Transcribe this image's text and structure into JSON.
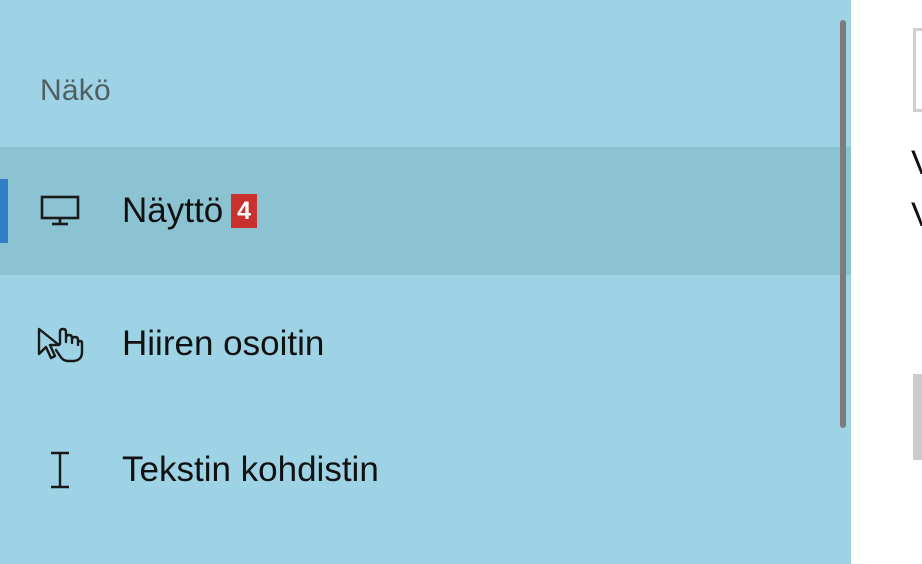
{
  "sidebar": {
    "section_heading": "Näkö",
    "items": [
      {
        "icon": "monitor-icon",
        "label": "Näyttö",
        "badge": "4",
        "selected": true
      },
      {
        "icon": "mouse-pointer-hand-icon",
        "label": "Hiiren osoitin",
        "selected": false
      },
      {
        "icon": "text-cursor-icon",
        "label": "Tekstin kohdistin",
        "selected": false
      }
    ]
  },
  "right_panel": {
    "line1_partial": "V",
    "line2_partial": "V"
  },
  "colors": {
    "sidebar_bg": "#9dd3e4",
    "selected_bg": "#8cc3d3",
    "accent": "#2f7ec6",
    "badge_bg": "#c8312e"
  }
}
